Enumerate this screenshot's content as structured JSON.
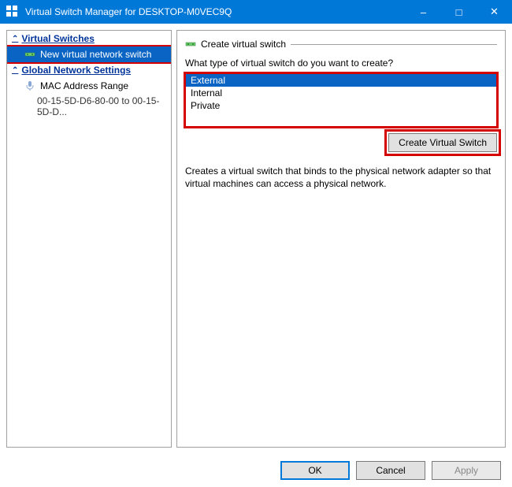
{
  "window": {
    "title": "Virtual Switch Manager for DESKTOP-M0VEC9Q"
  },
  "sidebar": {
    "sections": [
      {
        "header": "Virtual Switches",
        "items": [
          {
            "label": "New virtual network switch",
            "selected": true
          }
        ]
      },
      {
        "header": "Global Network Settings",
        "items": [
          {
            "label": "MAC Address Range",
            "detail": "00-15-5D-D6-80-00 to 00-15-5D-D..."
          }
        ]
      }
    ]
  },
  "main": {
    "section_title": "Create virtual switch",
    "question": "What type of virtual switch do you want to create?",
    "options": [
      "External",
      "Internal",
      "Private"
    ],
    "selected_option": "External",
    "create_btn": "Create Virtual Switch",
    "description": "Creates a virtual switch that binds to the physical network adapter so that virtual machines can access a physical network."
  },
  "footer": {
    "ok": "OK",
    "cancel": "Cancel",
    "apply": "Apply"
  }
}
